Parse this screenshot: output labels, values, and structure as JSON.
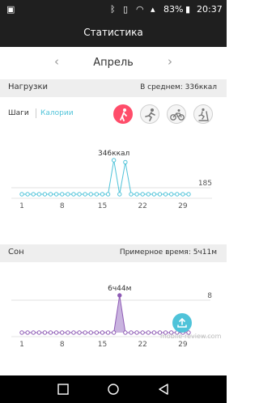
{
  "status_bar": {
    "icons": [
      "screen-capture-icon",
      "bluetooth-icon",
      "vibrate-icon",
      "wifi-icon",
      "signal-icon",
      "battery-icon"
    ],
    "battery_percent": "83%",
    "time": "20:37"
  },
  "header": {
    "title": "Статистика"
  },
  "month_nav": {
    "month": "Апрель"
  },
  "activity": {
    "title": "Нагрузки",
    "average": "В среднем: 336ккал",
    "tab_steps": "Шаги",
    "tab_calories": "Калории",
    "modes": [
      "walk-icon",
      "run-icon",
      "bike-icon",
      "treadmill-icon"
    ],
    "accent_color": "#4fc3d9",
    "active_mode_color": "#ff4d6a"
  },
  "sleep": {
    "title": "Сон",
    "estimated": "Примерное время: 5ч11м",
    "accent_color": "#8e5bb5"
  },
  "chart_data": [
    {
      "type": "line",
      "xticks": [
        1,
        8,
        15,
        22,
        29
      ],
      "x": [
        1,
        2,
        3,
        4,
        5,
        6,
        7,
        8,
        9,
        10,
        11,
        12,
        13,
        14,
        15,
        16,
        17,
        18,
        19,
        20,
        21,
        22,
        23,
        24,
        25,
        26,
        27,
        28,
        29,
        30
      ],
      "values": [
        0,
        0,
        0,
        0,
        0,
        0,
        0,
        0,
        0,
        0,
        0,
        0,
        0,
        0,
        0,
        0,
        346,
        0,
        326,
        0,
        0,
        0,
        0,
        0,
        0,
        0,
        0,
        0,
        0,
        0
      ],
      "reference_line_label": "185",
      "peak_label": "346ккал"
    },
    {
      "type": "area",
      "xticks": [
        1,
        8,
        15,
        22,
        29
      ],
      "x": [
        1,
        2,
        3,
        4,
        5,
        6,
        7,
        8,
        9,
        10,
        11,
        12,
        13,
        14,
        15,
        16,
        17,
        18,
        19,
        20,
        21,
        22,
        23,
        24,
        25,
        26,
        27,
        28,
        29,
        30
      ],
      "values": [
        0,
        0,
        0,
        0,
        0,
        0,
        0,
        0,
        0,
        0,
        0,
        0,
        0,
        0,
        0,
        0,
        0,
        6.73,
        0,
        0,
        0,
        0,
        0,
        0,
        0,
        0,
        0,
        0,
        0,
        0
      ],
      "reference_line_label": "8",
      "peak_label": "6ч44м"
    }
  ],
  "watermark": "mobile-review.com"
}
